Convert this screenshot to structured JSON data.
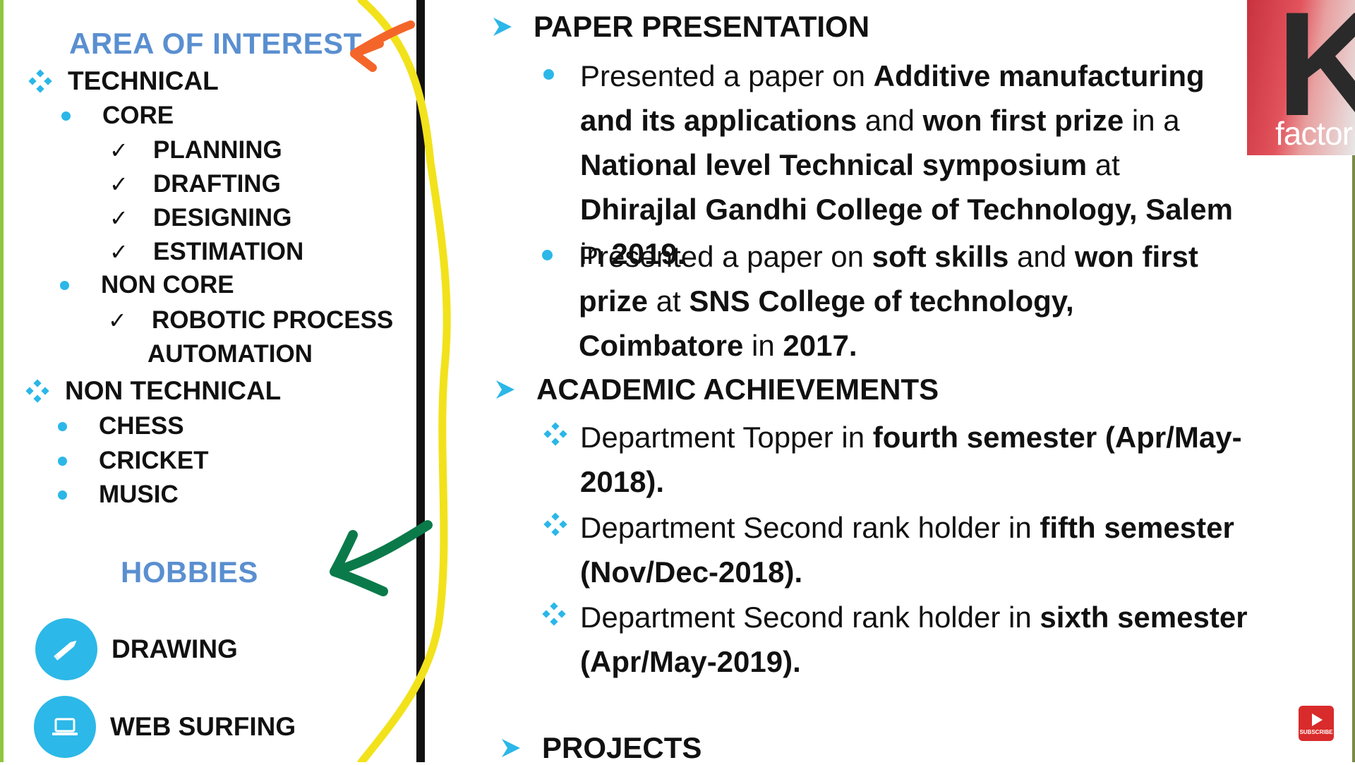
{
  "left": {
    "area_heading": "AREA OF INTEREST",
    "technical": "TECHNICAL",
    "core": "CORE",
    "core_items": [
      "PLANNING",
      "DRAFTING",
      "DESIGNING",
      "ESTIMATION"
    ],
    "non_core": "NON CORE",
    "non_core_items": [
      "ROBOTIC PROCESS",
      "AUTOMATION"
    ],
    "non_technical": "NON TECHNICAL",
    "non_technical_items": [
      "CHESS",
      "CRICKET",
      "MUSIC"
    ],
    "hobbies_heading": "HOBBIES",
    "hobbies": [
      {
        "label": "DRAWING",
        "icon": "pencil-icon"
      },
      {
        "label": "WEB SURFING",
        "icon": "laptop-icon"
      }
    ]
  },
  "right": {
    "paper_heading": "PAPER PRESENTATION",
    "paper1": {
      "t1": "Presented a paper on ",
      "b1": "Additive manufacturing and its applications",
      "t2": " and ",
      "b2": "won first prize",
      "t3": " in a ",
      "b3": "National level Technical symposium",
      "t4": " at ",
      "b4": "Dhirajlal Gandhi College of Technology, Salem",
      "t5": " in ",
      "b5": "2019."
    },
    "paper2": {
      "t1": "Presented a paper on ",
      "b1": "soft skills",
      "t2": " and ",
      "b2": "won first prize",
      "t3": " at ",
      "b3": "SNS College of technology, Coimbatore",
      "t4": " in ",
      "b4": "2017."
    },
    "academic_heading": "ACADEMIC ACHIEVEMENTS",
    "ach1": {
      "t1": "Department Topper in ",
      "b1": "fourth semester (Apr/May-2018)."
    },
    "ach2": {
      "t1": "Department Second rank holder in ",
      "b1": "fifth semester (Nov/Dec-2018)."
    },
    "ach3": {
      "t1": "Department Second rank holder in ",
      "b1": "sixth semester (Apr/May-2019)."
    },
    "projects_heading": "PROJECTS"
  },
  "logo": {
    "text": "factor",
    "letter": "K"
  },
  "subscribe": {
    "label": "SUBSCRIBE"
  },
  "colors": {
    "heading_blue": "#5a8fd0",
    "bullet_cyan": "#2bb7e8",
    "annotation_yellow": "#f2e21b",
    "annotation_orange": "#f4652a",
    "annotation_green": "#0a7a4a"
  }
}
